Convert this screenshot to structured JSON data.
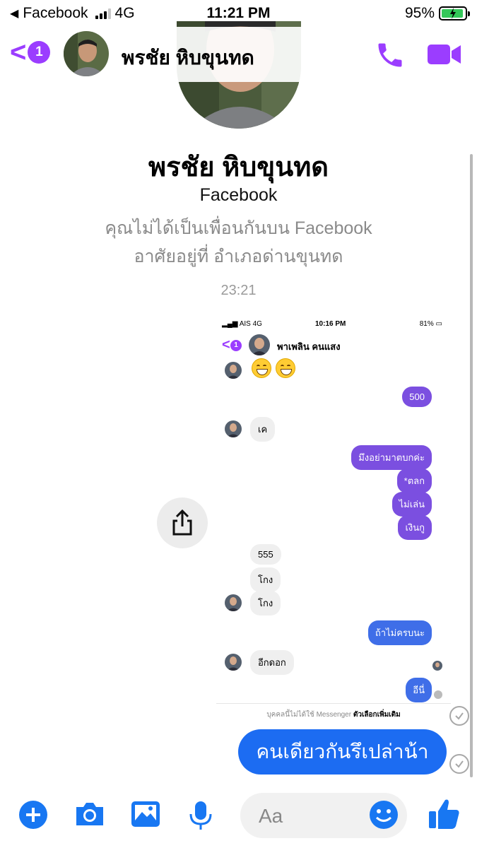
{
  "status_bar": {
    "back_app": "Facebook",
    "network": "4G",
    "time": "11:21 PM",
    "battery": "95%",
    "battery_level": 0.95
  },
  "header": {
    "back_badge_count": "1",
    "contact_name": "พรชัย หิบขุนทด"
  },
  "profile": {
    "name": "พรชัย หิบขุนทด",
    "platform": "Facebook",
    "friend_status": "คุณไม่ได้เป็นเพื่อนกันบน Facebook",
    "lives_in": "อาศัยอยู่ที่ อำเภอด่านขุนทด"
  },
  "timestamp": "23:21",
  "shared_screenshot": {
    "status_bar": {
      "carrier": "AIS",
      "network": "4G",
      "time": "10:16 PM",
      "battery": "81%"
    },
    "header": {
      "badge": "1",
      "name": "พาเพลิน คนแสง"
    },
    "messages_out_purple": [
      "500",
      "มึงอย่ามาตบกค่ะ",
      "*ตลก",
      "ไม่เล่น",
      "เงินกู"
    ],
    "messages_in": [
      "เค",
      "555",
      "โกง",
      "โกง",
      "อีกดอก"
    ],
    "messages_out_blue": [
      "ถ้าไม่ครบนะ",
      "อีนี่"
    ],
    "footer_text": "บุคคลนี้ไม่ได้ใช้ Messenger",
    "footer_link": "ตัวเลือกเพิ่มเติม"
  },
  "outgoing_message": "คนเดียวกันรึเปล่าน้า",
  "composer": {
    "placeholder": "Aa",
    "icons": [
      "plus-icon",
      "camera-icon",
      "image-icon",
      "microphone-icon",
      "emoji-icon",
      "thumbs-up-icon"
    ]
  },
  "colors": {
    "accent_purple": "#9b3dff",
    "blue": "#1c6cf2",
    "composer_blue": "#1877f2"
  }
}
